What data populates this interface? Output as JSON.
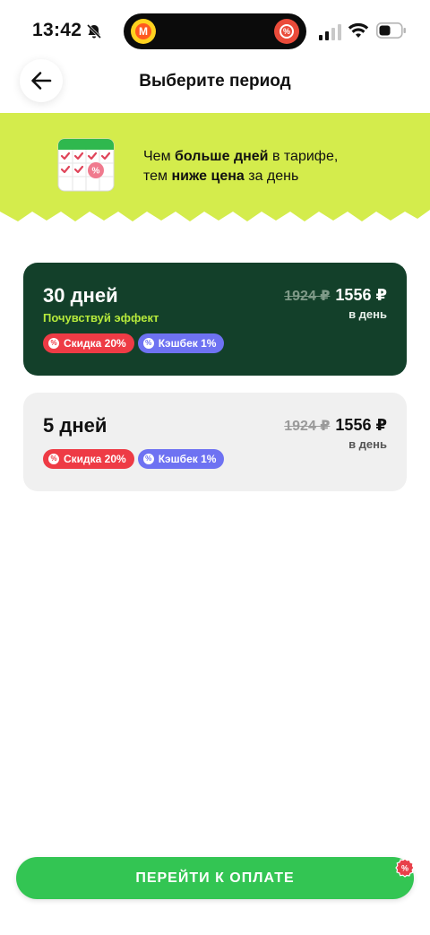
{
  "status_bar": {
    "time": "13:42"
  },
  "header": {
    "title": "Выберите период"
  },
  "banner": {
    "line1_pre": "Чем ",
    "line1_bold": "больше дней",
    "line1_post": " в тарифе,",
    "line2_pre": "тем ",
    "line2_bold": "ниже цена",
    "line2_post": " за день",
    "bg_color": "#d4ec4c"
  },
  "plans": [
    {
      "days": "30 дней",
      "subtitle": "Почувствуй эффект",
      "old_price": "1924 ₽",
      "new_price": "1556 ₽",
      "per_day": "в день",
      "discount_badge": "Скидка 20%",
      "cashback_badge": "Кэшбек 1%",
      "selected": true
    },
    {
      "days": "5 дней",
      "old_price": "1924 ₽",
      "new_price": "1556 ₽",
      "per_day": "в день",
      "discount_badge": "Скидка 20%",
      "cashback_badge": "Кэшбек 1%",
      "selected": false
    }
  ],
  "pay_button": {
    "label": "ПЕРЕЙТИ К ОПЛАТЕ"
  },
  "colors": {
    "accent_green": "#33c553",
    "dark_card": "#13402a",
    "discount": "#ee3b45",
    "cashback": "#6e72f2"
  },
  "icons": [
    "bell-off-icon",
    "signal-icon",
    "wifi-icon",
    "battery-icon",
    "back-arrow-icon",
    "calendar-icon",
    "percent-icon"
  ]
}
